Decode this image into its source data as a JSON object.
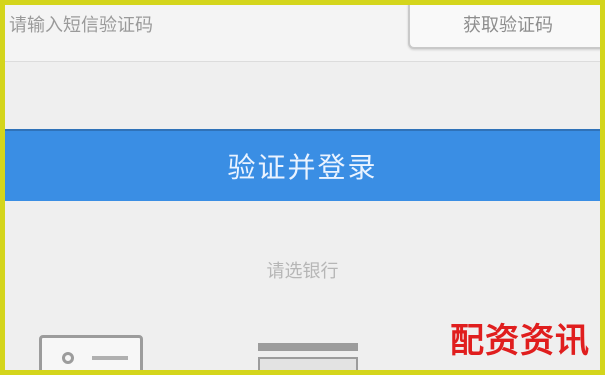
{
  "form": {
    "code_placeholder": "请输入短信验证码",
    "get_code_label": "获取验证码",
    "login_label": "验证并登录",
    "other_label": "请选银行"
  },
  "watermark": {
    "text": "配资资讯"
  },
  "colors": {
    "primary": "#3a8ee4",
    "background": "#efefef",
    "frame": "#d4d51c",
    "watermark": "#e01e1e"
  },
  "icons": [
    "card-icon",
    "bank-icon"
  ]
}
